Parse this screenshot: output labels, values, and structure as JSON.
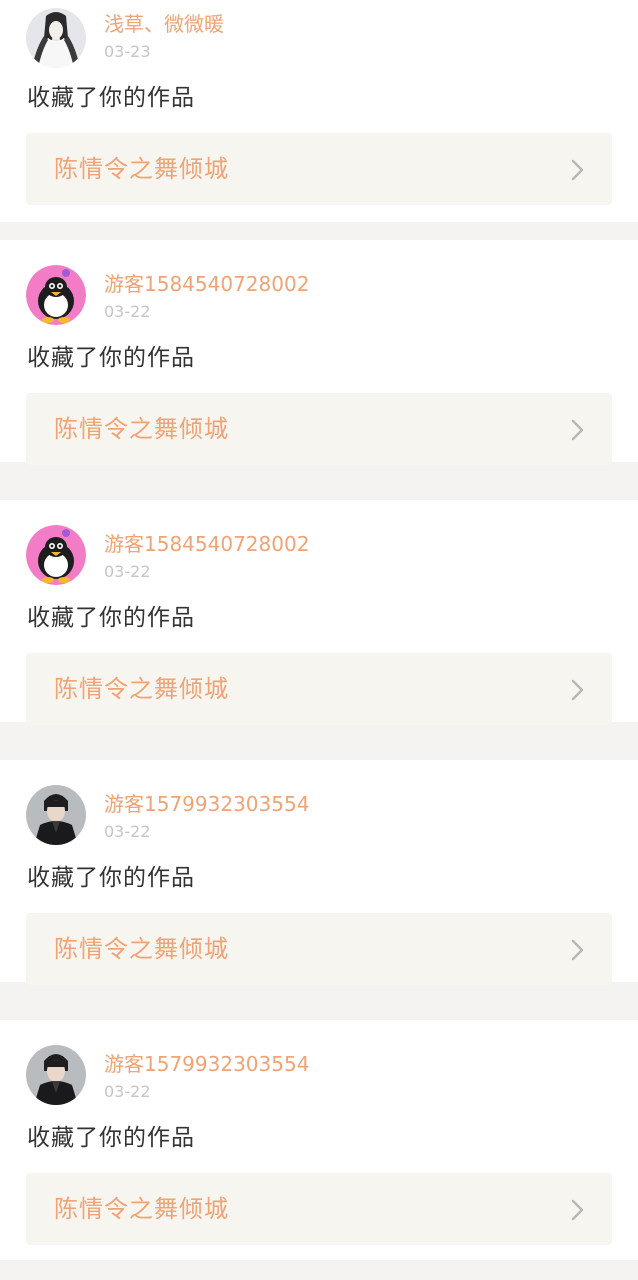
{
  "feed": {
    "items": [
      {
        "username": "浅草、微微暖",
        "date": "03-23",
        "action": "收藏了你的作品",
        "work_title": "陈情令之舞倾城",
        "avatar": "ink-portrait-avatar"
      },
      {
        "username": "游客1584540728002",
        "date": "03-22",
        "action": "收藏了你的作品",
        "work_title": "陈情令之舞倾城",
        "avatar": "penguin-avatar"
      },
      {
        "username": "游客1584540728002",
        "date": "03-22",
        "action": "收藏了你的作品",
        "work_title": "陈情令之舞倾城",
        "avatar": "penguin-avatar"
      },
      {
        "username": "游客1579932303554",
        "date": "03-22",
        "action": "收藏了你的作品",
        "work_title": "陈情令之舞倾城",
        "avatar": "dark-portrait-avatar"
      },
      {
        "username": "游客1579932303554",
        "date": "03-22",
        "action": "收藏了你的作品",
        "work_title": "陈情令之舞倾城",
        "avatar": "dark-portrait-avatar"
      }
    ]
  },
  "colors": {
    "accent": "#f0a374",
    "date": "#c6c6c6",
    "text": "#333333",
    "link_background": "#f6f5ef",
    "separator": "#f4f3f2"
  }
}
